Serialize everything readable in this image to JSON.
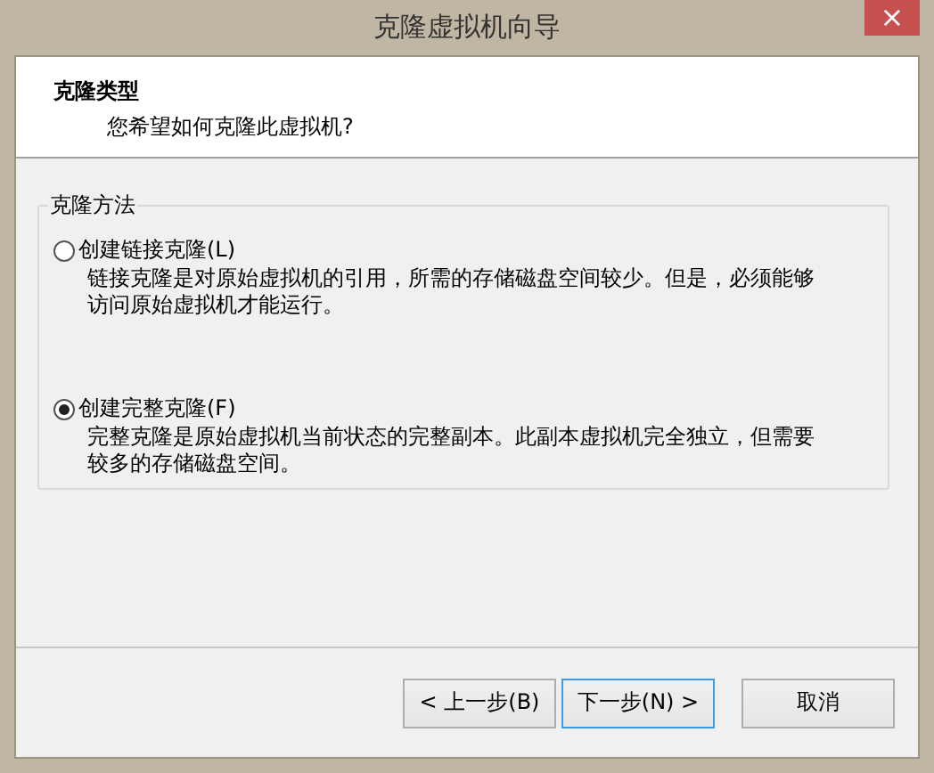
{
  "window": {
    "title": "克隆虚拟机向导",
    "close": "×"
  },
  "header": {
    "title": "克隆类型",
    "subtitle": "您希望如何克隆此虚拟机?"
  },
  "group": {
    "title": "克隆方法",
    "options": [
      {
        "label": "创建链接克隆(L)",
        "description": "链接克隆是对原始虚拟机的引用，所需的存储磁盘空间较少。但是，必须能够访问原始虚拟机才能运行。",
        "selected": false
      },
      {
        "label": "创建完整克隆(F)",
        "description": "完整克隆是原始虚拟机当前状态的完整副本。此副本虚拟机完全独立，但需要较多的存储磁盘空间。",
        "selected": true
      }
    ]
  },
  "buttons": [
    {
      "label": "< 上一步(B)",
      "focused": false
    },
    {
      "label": "下一步(N) >",
      "focused": true
    },
    {
      "label": "取消",
      "focused": false
    }
  ]
}
